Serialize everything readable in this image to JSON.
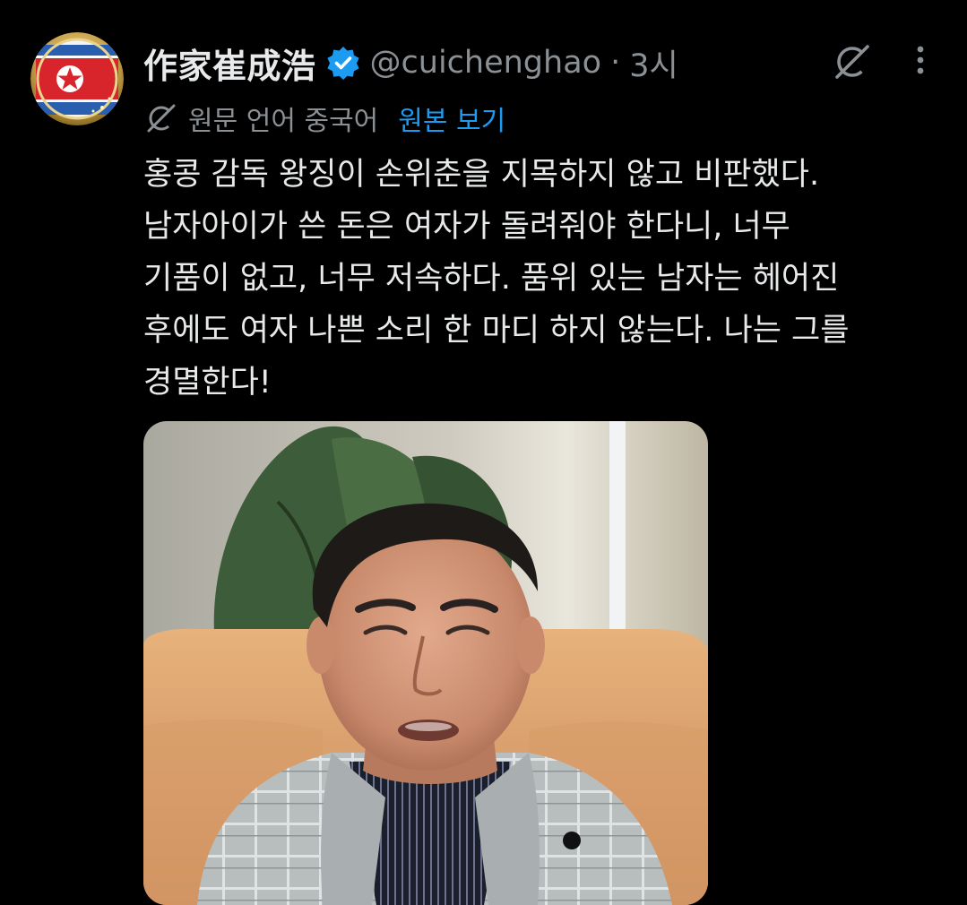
{
  "author": {
    "display_name": "作家崔成浩",
    "handle": "@cuichenghao",
    "separator": "·",
    "time": "3시"
  },
  "translation": {
    "label": "원문 언어 중국어",
    "show_original": "원본 보기"
  },
  "tweet": {
    "lines": [
      "홍콩 감독 왕징이 손위춘을 지목하지 않고 비판했다.",
      "남자아이가 쓴 돈은 여자가 돌려줘야 한다니, 너무",
      "기품이 없고, 너무 저속하다. 품위 있는 남자는 헤어진",
      "후에도 여자 나쁜 소리 한 마디 하지 않는다. 나는 그를",
      "경멸한다!"
    ]
  },
  "icons": {
    "verified": "verified-badge-icon",
    "grok": "grok-icon",
    "more": "more-options-icon",
    "translate": "grok-translate-icon"
  },
  "colors": {
    "background": "#000000",
    "text_primary": "#e7e9ea",
    "text_secondary": "#8b9095",
    "link": "#1d9bf0",
    "verified": "#1d9bf0"
  }
}
